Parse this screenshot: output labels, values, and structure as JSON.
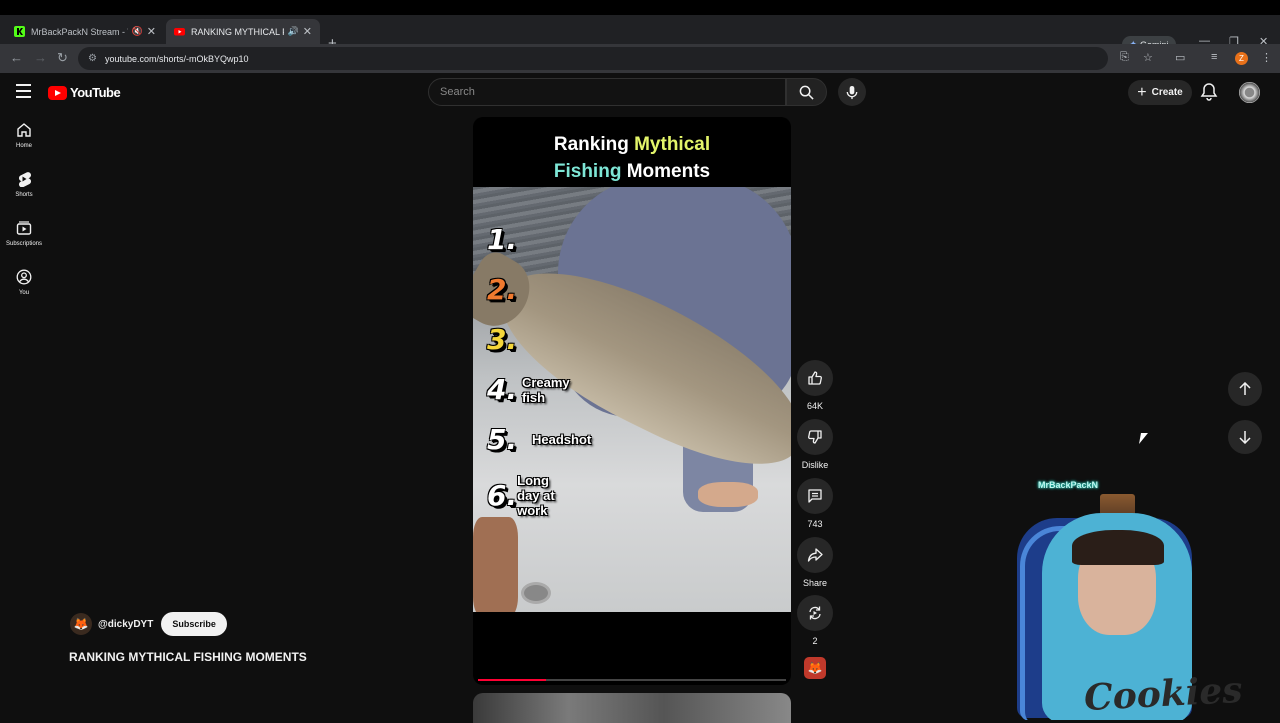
{
  "browser": {
    "tabs": [
      {
        "title": "MrBackPackN Stream - Wat",
        "active": false,
        "favicon_color": "#53fc18"
      },
      {
        "title": "RANKING MYTHICAL FISHIN",
        "active": true,
        "favicon_color": "#ff0000"
      }
    ],
    "gemini_label": "Gemini",
    "url": "youtube.com/shorts/-mOkBYQwp10",
    "profile_initial": "Z"
  },
  "youtube": {
    "logo_text": "YouTube",
    "search_placeholder": "Search",
    "create_label": "Create",
    "sidebar": [
      {
        "label": "Home",
        "icon": "home-icon"
      },
      {
        "label": "Shorts",
        "icon": "shorts-icon"
      },
      {
        "label": "Subscriptions",
        "icon": "subscriptions-icon"
      },
      {
        "label": "You",
        "icon": "you-icon"
      }
    ]
  },
  "short": {
    "overlay_title": {
      "line1_a": "Ranking ",
      "line1_b": "Mythical",
      "line2_a": "Fishing",
      "line2_b": " Moments"
    },
    "ranks": [
      {
        "num": "1.",
        "label": ""
      },
      {
        "num": "2.",
        "label": ""
      },
      {
        "num": "3.",
        "label": ""
      },
      {
        "num": "4.",
        "label": "Creamy fish"
      },
      {
        "num": "5.",
        "label": "Headshot"
      },
      {
        "num": "6.",
        "label": "Long day at work"
      }
    ],
    "progress": 0.22,
    "actions": {
      "likes": "64K",
      "dislike_label": "Dislike",
      "comments": "743",
      "share_label": "Share",
      "remix_count": "2"
    },
    "channel": "@dickyDYT",
    "subscribe_label": "Subscribe",
    "video_title": "RANKING MYTHICAL FISHING MOMENTS"
  },
  "webcam": {
    "streamer_name": "MrBackPackN",
    "hoodie_text": "Cookies"
  },
  "colors": {
    "yt_red": "#ff0000",
    "progress_red": "#ff0033",
    "title_yellow": "#e3f56a",
    "title_teal": "#7ee6d6",
    "rank_orange": "#f07a2f",
    "rank_yellow": "#f4d63a"
  }
}
